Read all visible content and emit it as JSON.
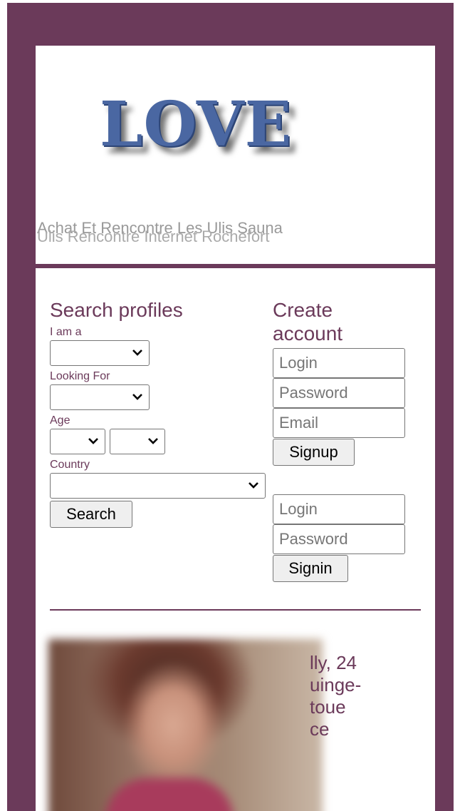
{
  "header": {
    "logo": "LOVE",
    "tagline_primary": "Achat Et Rencontre Les Ulis Sauna",
    "tagline_overlap": "Ulis Rencontre Internet Rochefort"
  },
  "search": {
    "title": "Search profiles",
    "i_am_label": "I am a",
    "looking_for_label": "Looking For",
    "age_label": "Age",
    "country_label": "Country",
    "search_button": "Search",
    "i_am_value": "",
    "looking_for_value": "",
    "age_from_value": "",
    "age_to_value": "",
    "country_value": ""
  },
  "account": {
    "title": "Create account",
    "login_placeholder": "Login",
    "password_placeholder": "Password",
    "email_placeholder": "Email",
    "signup_button": "Signup",
    "signin_login_placeholder": "Login",
    "signin_password_placeholder": "Password",
    "signin_button": "Signin"
  },
  "profile": {
    "name_age": "lly, 24",
    "line2": "uinge-",
    "line3": "toue",
    "line4": "ce"
  },
  "colors": {
    "frame": "#6b3a5a",
    "logo": "#4a67a2",
    "text_accent": "#6b3a5a"
  },
  "icons": [
    "chevron-down-icon"
  ]
}
